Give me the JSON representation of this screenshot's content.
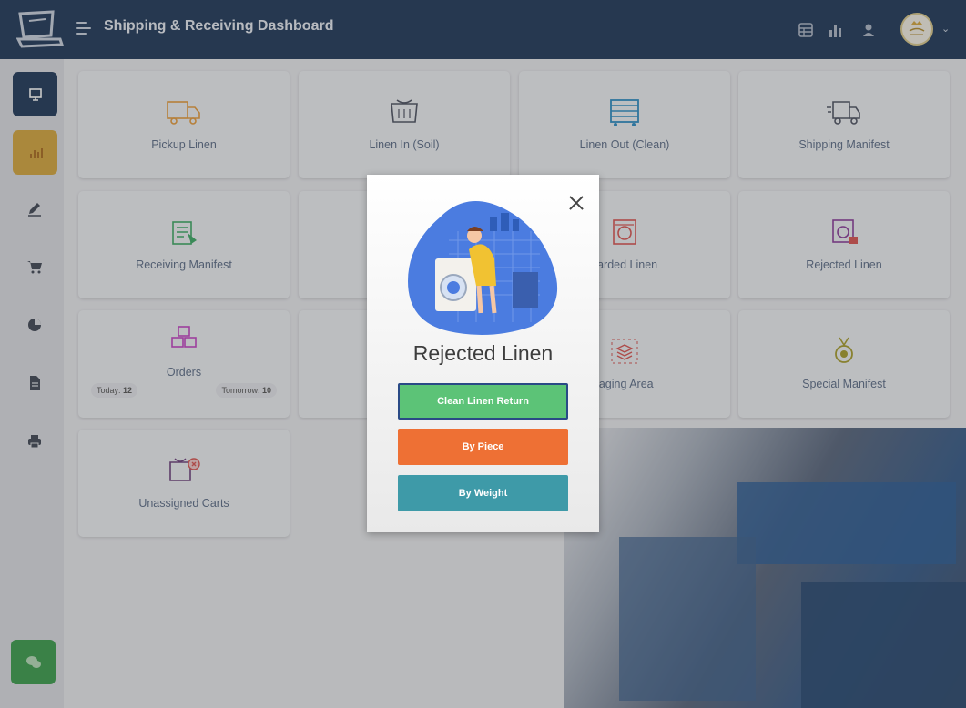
{
  "header": {
    "title": "Shipping & Receiving Dashboard",
    "icons": [
      "logo-icon",
      "menu-icon",
      "table-icon",
      "bar-chart-icon",
      "user-icon",
      "avatar",
      "chevron-down-icon"
    ]
  },
  "sidebar": {
    "items": [
      {
        "icon": "monitor-icon",
        "active": true,
        "color": "#1e3658"
      },
      {
        "icon": "chart-icon",
        "active": false,
        "color": "#d4a63c"
      },
      {
        "icon": "pen-icon"
      },
      {
        "icon": "cart-icon"
      },
      {
        "icon": "pie-chart-icon"
      },
      {
        "icon": "document-icon"
      },
      {
        "icon": "printer-icon"
      },
      {
        "icon": "chat-icon",
        "color": "#3a9c4b"
      }
    ]
  },
  "tiles": [
    {
      "label": "Pickup Linen",
      "icon": "truck-icon",
      "color": "#e59a3a"
    },
    {
      "label": "Linen In (Soil)",
      "icon": "soiled-cart-icon",
      "color": "#4b5160"
    },
    {
      "label": "Linen Out (Clean)",
      "icon": "clean-cart-icon",
      "color": "#2a8bc2"
    },
    {
      "label": "Shipping Manifest",
      "icon": "delivery-truck-icon",
      "color": "#4b5160"
    },
    {
      "label": "Receiving Manifest",
      "icon": "manifest-icon",
      "color": "#3aa863"
    },
    {
      "label": "carded Linen",
      "icon": "washer-icon",
      "color": "#d9534f"
    },
    {
      "label": "Rejected Linen",
      "icon": "rejected-washer-icon",
      "color": "#8a3b9a"
    },
    {
      "label": "Orders",
      "icon": "boxes-icon",
      "color": "#c240c2",
      "today_label": "Today:",
      "today_value": "12",
      "tomorrow_label": "Tomorrow:",
      "tomorrow_value": "10"
    },
    {
      "label": "taging Area",
      "icon": "layers-icon",
      "color": "#d9534f"
    },
    {
      "label": "Special Manifest",
      "icon": "medal-icon",
      "color": "#a59b2a"
    },
    {
      "label": "Unassigned Carts",
      "icon": "cart-x-icon",
      "color": "#6a3d7a"
    }
  ],
  "modal": {
    "title": "Rejected Linen",
    "buttons": [
      {
        "label": "Clean Linen Return",
        "color": "#5cc377",
        "border": "#2a4a86"
      },
      {
        "label": "By Piece",
        "color": "#ee7034"
      },
      {
        "label": "By Weight",
        "color": "#3e9aa8"
      }
    ]
  }
}
